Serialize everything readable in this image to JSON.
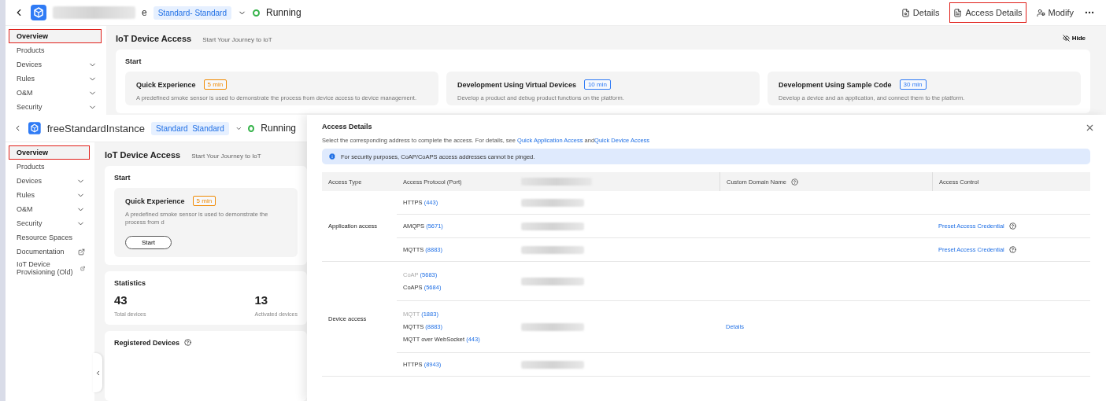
{
  "top_view": {
    "header": {
      "instance_name": "e",
      "tag": "Standard- Standard",
      "status": "Running",
      "actions": [
        {
          "label": "Details",
          "kind": "details",
          "highlighted": false
        },
        {
          "label": "Access Details",
          "kind": "access",
          "highlighted": true
        },
        {
          "label": "Modify",
          "kind": "modify",
          "highlighted": false
        }
      ]
    },
    "sidebar": {
      "items": [
        {
          "label": "Overview",
          "kind": "plain",
          "selected": true,
          "highlighted": true
        },
        {
          "label": "Products",
          "kind": "plain",
          "selected": false,
          "highlighted": false
        },
        {
          "label": "Devices",
          "kind": "expand",
          "selected": false,
          "highlighted": false
        },
        {
          "label": "Rules",
          "kind": "expand",
          "selected": false,
          "highlighted": false
        },
        {
          "label": "O&M",
          "kind": "expand",
          "selected": false,
          "highlighted": false
        },
        {
          "label": "Security",
          "kind": "expand",
          "selected": false,
          "highlighted": false
        }
      ]
    },
    "content": {
      "title": "IoT Device Access",
      "subtitle": "Start Your Journey to IoT",
      "hide_label": "Hide",
      "start": {
        "title": "Start",
        "cards": [
          {
            "title": "Quick Experience",
            "time": "5 min",
            "color": "#f08a00",
            "description": "A predefined smoke sensor is used to demonstrate the process from device access to device management."
          },
          {
            "title": "Development Using Virtual Devices",
            "time": "10 min",
            "color": "#2f7bf5",
            "description": "Develop a product and debug product functions on the platform."
          },
          {
            "title": "Development Using Sample Code",
            "time": "30 min",
            "color": "#2f7bf5",
            "description": "Develop a device and an application, and connect them to the platform."
          }
        ]
      }
    }
  },
  "bottom_view": {
    "header": {
      "instance_name": "freeStandardInstance",
      "tag": "Standard  Standard",
      "status": "Running"
    },
    "sidebar": {
      "items": [
        {
          "label": "Overview",
          "kind": "plain",
          "selected": true,
          "highlighted": true
        },
        {
          "label": "Products",
          "kind": "plain",
          "selected": false,
          "highlighted": false
        },
        {
          "label": "Devices",
          "kind": "expand",
          "selected": false,
          "highlighted": false
        },
        {
          "label": "Rules",
          "kind": "expand",
          "selected": false,
          "highlighted": false
        },
        {
          "label": "O&M",
          "kind": "expand",
          "selected": false,
          "highlighted": false
        },
        {
          "label": "Security",
          "kind": "expand",
          "selected": false,
          "highlighted": false
        },
        {
          "label": "Resource Spaces",
          "kind": "plain",
          "selected": false,
          "highlighted": false
        },
        {
          "label": "Documentation",
          "kind": "external",
          "selected": false,
          "highlighted": false
        },
        {
          "label": "IoT Device Provisioning (Old)",
          "kind": "external",
          "selected": false,
          "highlighted": false
        }
      ]
    },
    "content": {
      "title": "IoT Device Access",
      "subtitle": "Start Your Journey to IoT",
      "start": {
        "title": "Start",
        "card": {
          "title": "Quick Experience",
          "time": "5 min",
          "color": "#f08a00",
          "description": "A predefined smoke sensor is used to demonstrate the process from d",
          "button": "Start"
        }
      },
      "statistics": {
        "title": "Statistics",
        "items": [
          {
            "value": "43",
            "label": "Total devices"
          },
          {
            "value": "13",
            "label": "Activated devices"
          }
        ]
      },
      "registered_title": "Registered Devices"
    }
  },
  "drawer": {
    "title": "Access Details",
    "intro": "Select the corresponding address to complete the access. For details, see ",
    "links": [
      "Quick Application Access",
      "Quick Device Access"
    ],
    "joiner": " and",
    "notice": "For security purposes, CoAP/CoAPS access addresses cannot be pinged.",
    "columns": [
      {
        "kind": "text",
        "label": "Access Type"
      },
      {
        "kind": "text",
        "label": "Access Protocol (Port)"
      },
      {
        "kind": "redacted"
      },
      {
        "kind": "help",
        "label": "Custom Domain Name"
      },
      {
        "kind": "text",
        "label": "Access Control"
      }
    ],
    "groups": [
      {
        "access_type": "Application access",
        "rows": [
          {
            "protocols": [
              {
                "name": "HTTPS",
                "port": "(443)",
                "disabled": false
              }
            ]
          },
          {
            "protocols": [
              {
                "name": "AMQPS",
                "port": "(5671)",
                "disabled": false
              }
            ],
            "control": "Preset Access Credential"
          },
          {
            "protocols": [
              {
                "name": "MQTTS",
                "port": "(8883)",
                "disabled": false
              }
            ],
            "control": "Preset Access Credential"
          }
        ]
      },
      {
        "access_type": "Device access",
        "rows": [
          {
            "protocols": [
              {
                "name": "CoAP",
                "port": "(5683)",
                "disabled": true
              },
              {
                "name": "CoAPS",
                "port": "(5684)",
                "disabled": false
              }
            ]
          },
          {
            "protocols": [
              {
                "name": "MQTT",
                "port": "(1883)",
                "disabled": true
              },
              {
                "name": "MQTTS",
                "port": "(8883)",
                "disabled": false
              },
              {
                "name": "MQTT over WebSocket",
                "port": "(443)",
                "disabled": false
              }
            ],
            "domain": "Details"
          },
          {
            "protocols": [
              {
                "name": "HTTPS",
                "port": "(8943)",
                "disabled": false
              }
            ]
          }
        ]
      }
    ]
  }
}
